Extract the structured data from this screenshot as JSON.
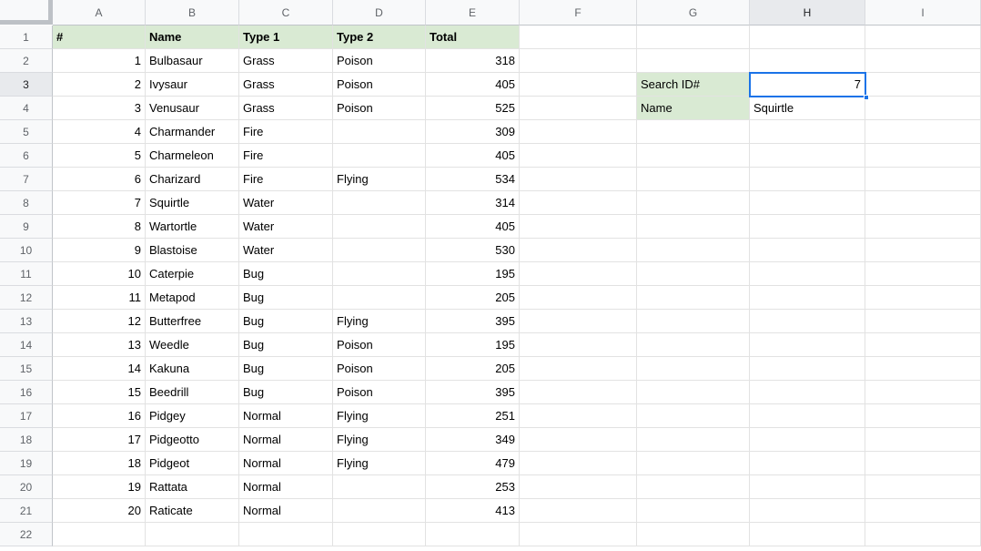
{
  "sheet": {
    "column_headers": [
      "A",
      "B",
      "C",
      "D",
      "E",
      "F",
      "G",
      "H",
      "I"
    ],
    "row_numbers": [
      "1",
      "2",
      "3",
      "4",
      "5",
      "6",
      "7",
      "8",
      "9",
      "10",
      "11",
      "12",
      "13",
      "14",
      "15",
      "16",
      "17",
      "18",
      "19",
      "20",
      "21",
      "22"
    ],
    "table": {
      "headers": [
        "#",
        "Name",
        "Type 1",
        "Type 2",
        "Total"
      ],
      "rows": [
        {
          "id": "1",
          "name": "Bulbasaur",
          "type1": "Grass",
          "type2": "Poison",
          "total": "318"
        },
        {
          "id": "2",
          "name": "Ivysaur",
          "type1": "Grass",
          "type2": "Poison",
          "total": "405"
        },
        {
          "id": "3",
          "name": "Venusaur",
          "type1": "Grass",
          "type2": "Poison",
          "total": "525"
        },
        {
          "id": "4",
          "name": "Charmander",
          "type1": "Fire",
          "type2": "",
          "total": "309"
        },
        {
          "id": "5",
          "name": "Charmeleon",
          "type1": "Fire",
          "type2": "",
          "total": "405"
        },
        {
          "id": "6",
          "name": "Charizard",
          "type1": "Fire",
          "type2": "Flying",
          "total": "534"
        },
        {
          "id": "7",
          "name": "Squirtle",
          "type1": "Water",
          "type2": "",
          "total": "314"
        },
        {
          "id": "8",
          "name": "Wartortle",
          "type1": "Water",
          "type2": "",
          "total": "405"
        },
        {
          "id": "9",
          "name": "Blastoise",
          "type1": "Water",
          "type2": "",
          "total": "530"
        },
        {
          "id": "10",
          "name": "Caterpie",
          "type1": "Bug",
          "type2": "",
          "total": "195"
        },
        {
          "id": "11",
          "name": "Metapod",
          "type1": "Bug",
          "type2": "",
          "total": "205"
        },
        {
          "id": "12",
          "name": "Butterfree",
          "type1": "Bug",
          "type2": "Flying",
          "total": "395"
        },
        {
          "id": "13",
          "name": "Weedle",
          "type1": "Bug",
          "type2": "Poison",
          "total": "195"
        },
        {
          "id": "14",
          "name": "Kakuna",
          "type1": "Bug",
          "type2": "Poison",
          "total": "205"
        },
        {
          "id": "15",
          "name": "Beedrill",
          "type1": "Bug",
          "type2": "Poison",
          "total": "395"
        },
        {
          "id": "16",
          "name": "Pidgey",
          "type1": "Normal",
          "type2": "Flying",
          "total": "251"
        },
        {
          "id": "17",
          "name": "Pidgeotto",
          "type1": "Normal",
          "type2": "Flying",
          "total": "349"
        },
        {
          "id": "18",
          "name": "Pidgeot",
          "type1": "Normal",
          "type2": "Flying",
          "total": "479"
        },
        {
          "id": "19",
          "name": "Rattata",
          "type1": "Normal",
          "type2": "",
          "total": "253"
        },
        {
          "id": "20",
          "name": "Raticate",
          "type1": "Normal",
          "type2": "",
          "total": "413"
        }
      ]
    },
    "lookup": {
      "search_label": "Search ID#",
      "search_value": "7",
      "name_label": "Name",
      "name_value": "Squirtle"
    },
    "selection": {
      "selected_cell": "H3",
      "selected_column": "H",
      "selected_row": "3"
    },
    "colors": {
      "header_green": "#d9ead3",
      "selection_blue": "#1a73e8",
      "header_bg": "#f8f9fa",
      "header_active_bg": "#e8eaed",
      "gridline": "#e2e2e2"
    }
  }
}
